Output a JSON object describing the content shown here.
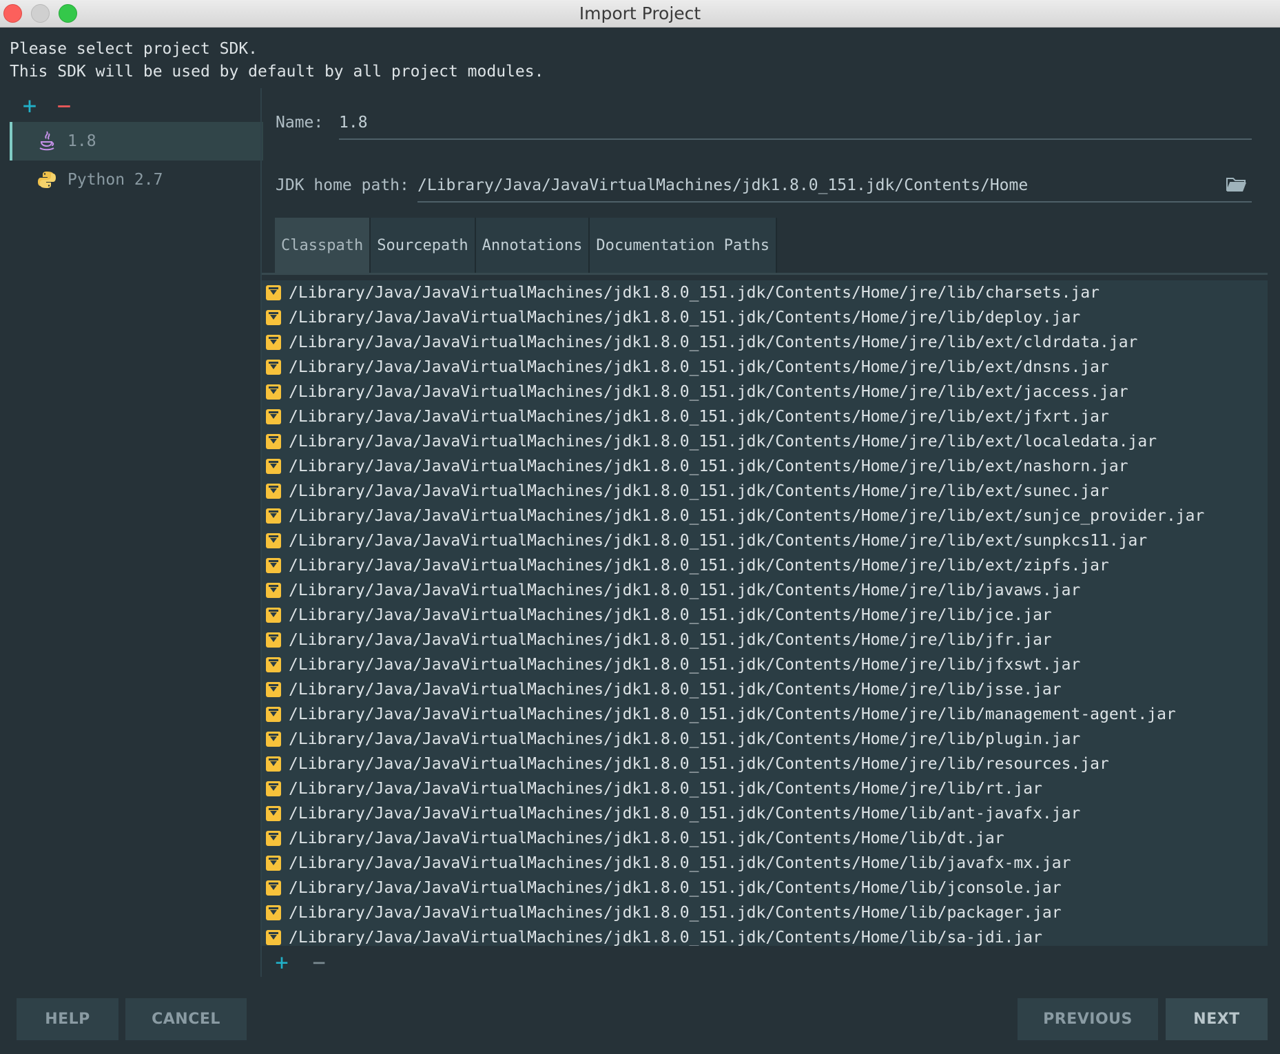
{
  "window": {
    "title": "Import Project"
  },
  "intro": {
    "line1": "Please select project SDK.",
    "line2": "This SDK will be used by default by all project modules."
  },
  "sdk_toolbar": {
    "add": "+",
    "remove": "−"
  },
  "sdks": [
    {
      "label": "1.8",
      "icon": "java-icon",
      "selected": true
    },
    {
      "label": "Python 2.7",
      "icon": "python-icon",
      "selected": false
    }
  ],
  "form": {
    "name_label": "Name:",
    "name_value": "1.8",
    "jdk_label": "JDK home path:",
    "jdk_value": "/Library/Java/JavaVirtualMachines/jdk1.8.0_151.jdk/Contents/Home"
  },
  "tabs": [
    {
      "label": "Classpath",
      "active": true
    },
    {
      "label": "Sourcepath",
      "active": false
    },
    {
      "label": "Annotations",
      "active": false
    },
    {
      "label": "Documentation Paths",
      "active": false
    }
  ],
  "classpath": [
    "/Library/Java/JavaVirtualMachines/jdk1.8.0_151.jdk/Contents/Home/jre/lib/charsets.jar",
    "/Library/Java/JavaVirtualMachines/jdk1.8.0_151.jdk/Contents/Home/jre/lib/deploy.jar",
    "/Library/Java/JavaVirtualMachines/jdk1.8.0_151.jdk/Contents/Home/jre/lib/ext/cldrdata.jar",
    "/Library/Java/JavaVirtualMachines/jdk1.8.0_151.jdk/Contents/Home/jre/lib/ext/dnsns.jar",
    "/Library/Java/JavaVirtualMachines/jdk1.8.0_151.jdk/Contents/Home/jre/lib/ext/jaccess.jar",
    "/Library/Java/JavaVirtualMachines/jdk1.8.0_151.jdk/Contents/Home/jre/lib/ext/jfxrt.jar",
    "/Library/Java/JavaVirtualMachines/jdk1.8.0_151.jdk/Contents/Home/jre/lib/ext/localedata.jar",
    "/Library/Java/JavaVirtualMachines/jdk1.8.0_151.jdk/Contents/Home/jre/lib/ext/nashorn.jar",
    "/Library/Java/JavaVirtualMachines/jdk1.8.0_151.jdk/Contents/Home/jre/lib/ext/sunec.jar",
    "/Library/Java/JavaVirtualMachines/jdk1.8.0_151.jdk/Contents/Home/jre/lib/ext/sunjce_provider.jar",
    "/Library/Java/JavaVirtualMachines/jdk1.8.0_151.jdk/Contents/Home/jre/lib/ext/sunpkcs11.jar",
    "/Library/Java/JavaVirtualMachines/jdk1.8.0_151.jdk/Contents/Home/jre/lib/ext/zipfs.jar",
    "/Library/Java/JavaVirtualMachines/jdk1.8.0_151.jdk/Contents/Home/jre/lib/javaws.jar",
    "/Library/Java/JavaVirtualMachines/jdk1.8.0_151.jdk/Contents/Home/jre/lib/jce.jar",
    "/Library/Java/JavaVirtualMachines/jdk1.8.0_151.jdk/Contents/Home/jre/lib/jfr.jar",
    "/Library/Java/JavaVirtualMachines/jdk1.8.0_151.jdk/Contents/Home/jre/lib/jfxswt.jar",
    "/Library/Java/JavaVirtualMachines/jdk1.8.0_151.jdk/Contents/Home/jre/lib/jsse.jar",
    "/Library/Java/JavaVirtualMachines/jdk1.8.0_151.jdk/Contents/Home/jre/lib/management-agent.jar",
    "/Library/Java/JavaVirtualMachines/jdk1.8.0_151.jdk/Contents/Home/jre/lib/plugin.jar",
    "/Library/Java/JavaVirtualMachines/jdk1.8.0_151.jdk/Contents/Home/jre/lib/resources.jar",
    "/Library/Java/JavaVirtualMachines/jdk1.8.0_151.jdk/Contents/Home/jre/lib/rt.jar",
    "/Library/Java/JavaVirtualMachines/jdk1.8.0_151.jdk/Contents/Home/lib/ant-javafx.jar",
    "/Library/Java/JavaVirtualMachines/jdk1.8.0_151.jdk/Contents/Home/lib/dt.jar",
    "/Library/Java/JavaVirtualMachines/jdk1.8.0_151.jdk/Contents/Home/lib/javafx-mx.jar",
    "/Library/Java/JavaVirtualMachines/jdk1.8.0_151.jdk/Contents/Home/lib/jconsole.jar",
    "/Library/Java/JavaVirtualMachines/jdk1.8.0_151.jdk/Contents/Home/lib/packager.jar",
    "/Library/Java/JavaVirtualMachines/jdk1.8.0_151.jdk/Contents/Home/lib/sa-jdi.jar"
  ],
  "classpath_toolbar": {
    "add": "+",
    "remove": "−"
  },
  "buttons": {
    "help": "HELP",
    "cancel": "CANCEL",
    "previous": "PREVIOUS",
    "next": "NEXT"
  },
  "colors": {
    "background": "#263238",
    "accent": "#80cbc4",
    "add": "#21b0c8",
    "remove": "#ef5a5a",
    "jar": "#f7c23b"
  }
}
